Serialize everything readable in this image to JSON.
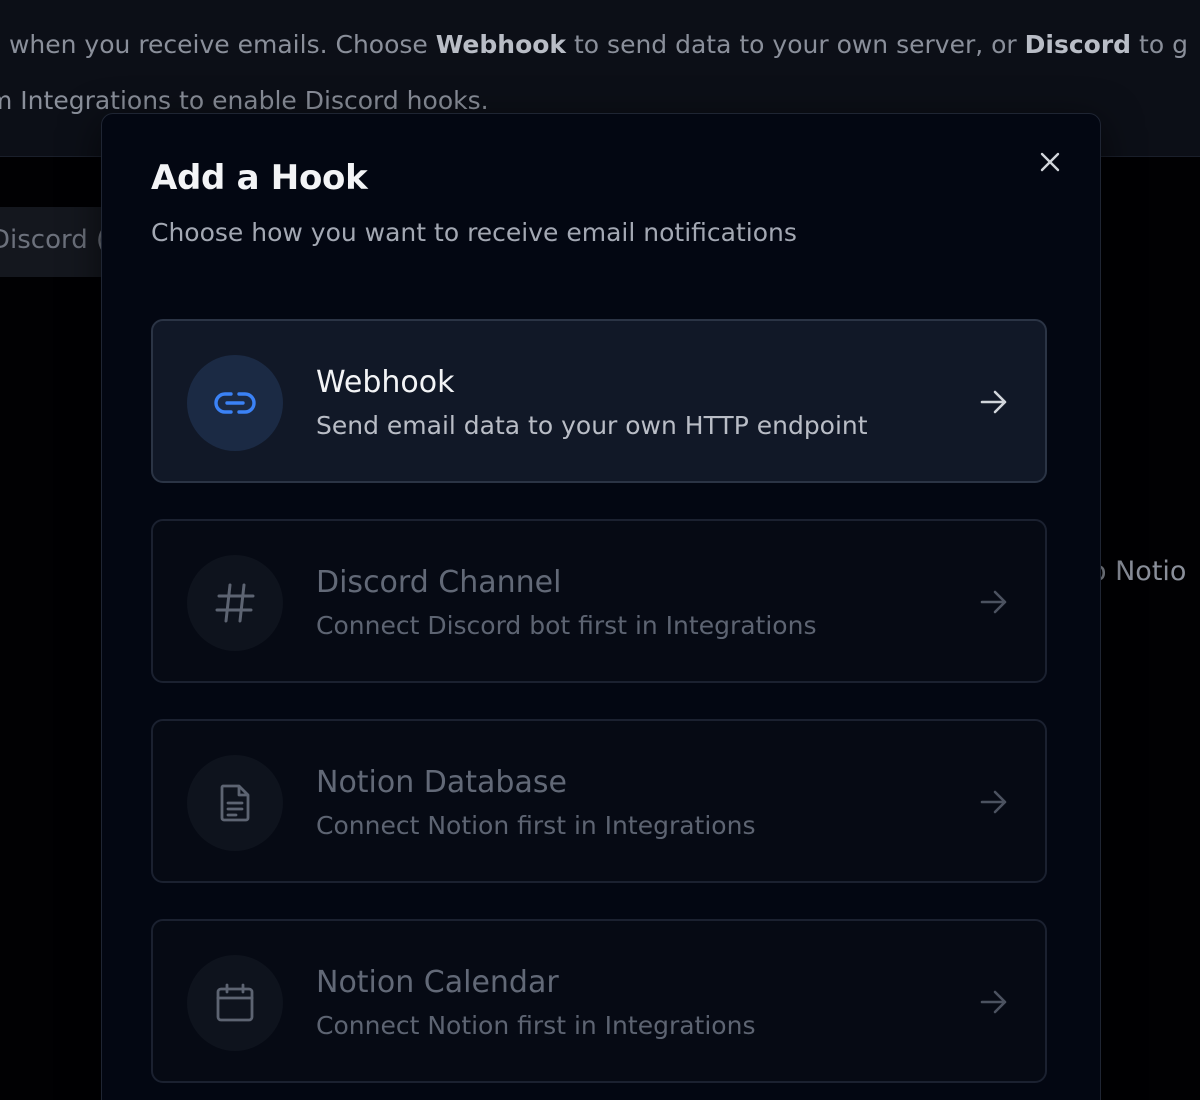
{
  "background": {
    "line1_prefix": "s when you receive emails. Choose ",
    "line1_bold1": "Webhook",
    "line1_mid": " to send data to your own server, or ",
    "line1_bold2": "Discord",
    "line1_suffix": " to g",
    "line2": "m Integrations to enable Discord hooks.",
    "tab_label": "Discord (",
    "right_text": "o Notio"
  },
  "modal": {
    "title": "Add a Hook",
    "subtitle": "Choose how you want to receive email notifications",
    "options": [
      {
        "title": "Webhook",
        "description": "Send email data to your own HTTP endpoint",
        "icon": "link-icon",
        "enabled": true
      },
      {
        "title": "Discord Channel",
        "description": "Connect Discord bot first in Integrations",
        "icon": "hash-icon",
        "enabled": false
      },
      {
        "title": "Notion Database",
        "description": "Connect Notion first in Integrations",
        "icon": "document-icon",
        "enabled": false
      },
      {
        "title": "Notion Calendar",
        "description": "Connect Notion first in Integrations",
        "icon": "calendar-icon",
        "enabled": false
      }
    ]
  },
  "colors": {
    "accent": "#3b82f6",
    "modal_bg": "#030712",
    "active_card_bg": "#111827"
  }
}
